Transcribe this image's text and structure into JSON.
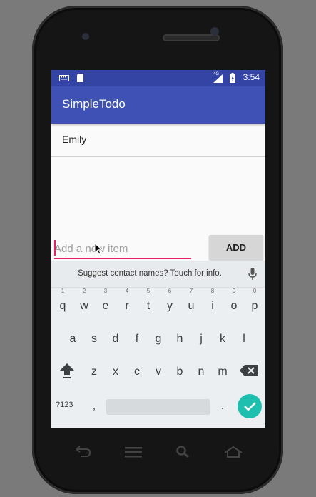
{
  "status_bar": {
    "time": "3:54",
    "network": "4G"
  },
  "app_bar": {
    "title": "SimpleTodo"
  },
  "todo_list": {
    "items": [
      "Emily"
    ]
  },
  "new_item": {
    "placeholder": "Add a new item",
    "value": ""
  },
  "add_button": {
    "label": "ADD"
  },
  "keyboard": {
    "suggestion": "Suggest contact names? Touch for info.",
    "row1": [
      "q",
      "w",
      "e",
      "r",
      "t",
      "y",
      "u",
      "i",
      "o",
      "p"
    ],
    "row1_hints": [
      "1",
      "2",
      "3",
      "4",
      "5",
      "6",
      "7",
      "8",
      "9",
      "0"
    ],
    "row2": [
      "a",
      "s",
      "d",
      "f",
      "g",
      "h",
      "j",
      "k",
      "l"
    ],
    "row3": [
      "z",
      "x",
      "c",
      "v",
      "b",
      "n",
      "m"
    ],
    "symbols_label": "?123",
    "comma": ",",
    "period": ".",
    "enter_color": "#1fbfb0"
  },
  "colors": {
    "app_bar": "#3f51b5",
    "status_bar": "#3344a4",
    "accent": "#e91e63"
  }
}
